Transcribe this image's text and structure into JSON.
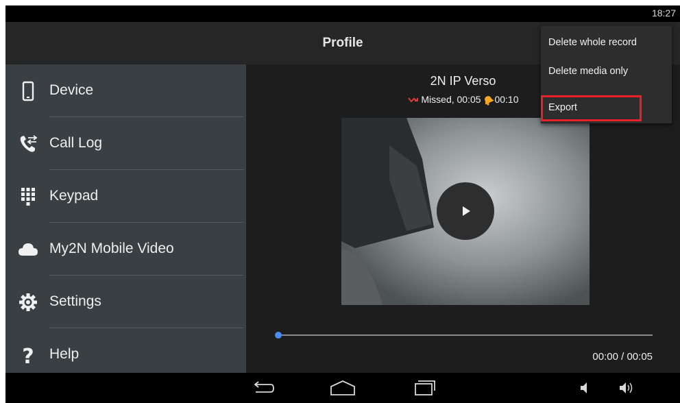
{
  "status_bar": {
    "time": "18:27"
  },
  "action_bar": {
    "title": "Profile"
  },
  "sidebar": {
    "items": [
      {
        "label": "Device",
        "icon": "phone-device-icon"
      },
      {
        "label": "Call Log",
        "icon": "call-log-icon"
      },
      {
        "label": "Keypad",
        "icon": "keypad-icon"
      },
      {
        "label": "My2N Mobile Video",
        "icon": "cloud-icon"
      },
      {
        "label": "Settings",
        "icon": "gear-icon"
      },
      {
        "label": "Help",
        "icon": "help-icon"
      }
    ]
  },
  "record": {
    "caller": "2N IP Verso",
    "status": "Missed, 00:05",
    "ring_duration": "00:10",
    "missed_color": "#e53935",
    "bell_color": "#f5a623"
  },
  "player": {
    "time": "00:00 / 00:05",
    "progress": 0,
    "accent": "#4a8df0"
  },
  "menu": {
    "items": [
      "Delete whole record",
      "Delete media only",
      "Export"
    ],
    "highlighted": "Export",
    "highlight_color": "#e8202a"
  }
}
